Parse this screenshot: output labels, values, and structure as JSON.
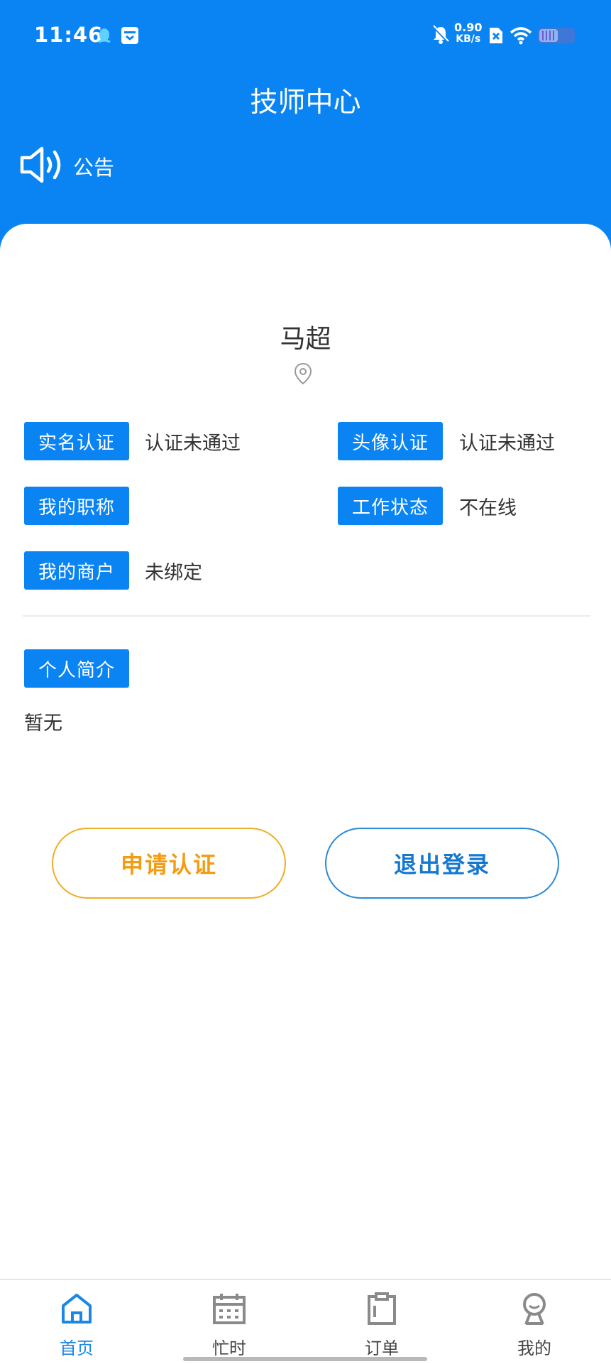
{
  "statusbar": {
    "time": "11:46",
    "net_speed_value": "0.90",
    "net_speed_unit": "KB/s"
  },
  "header": {
    "title": "技师中心",
    "announcement_label": "公告"
  },
  "profile": {
    "name": "马超",
    "fields": {
      "realname": {
        "label": "实名认证",
        "value": "认证未通过"
      },
      "avatar": {
        "label": "头像认证",
        "value": "认证未通过"
      },
      "title": {
        "label": "我的职称",
        "value": ""
      },
      "work_status": {
        "label": "工作状态",
        "value": "不在线"
      },
      "merchant": {
        "label": "我的商户",
        "value": "未绑定"
      }
    },
    "intro": {
      "label": "个人简介",
      "value": "暂无"
    }
  },
  "actions": {
    "apply_label": "申请认证",
    "logout_label": "退出登录"
  },
  "tabbar": {
    "items": [
      {
        "label": "首页",
        "icon": "home-icon",
        "active": true
      },
      {
        "label": "忙时",
        "icon": "calendar-icon",
        "active": false
      },
      {
        "label": "订单",
        "icon": "clipboard-icon",
        "active": false
      },
      {
        "label": "我的",
        "icon": "user-icon",
        "active": false
      }
    ]
  },
  "colors": {
    "primary": "#0b84f3",
    "apply": "#f39c12",
    "logout": "#1578d0"
  }
}
